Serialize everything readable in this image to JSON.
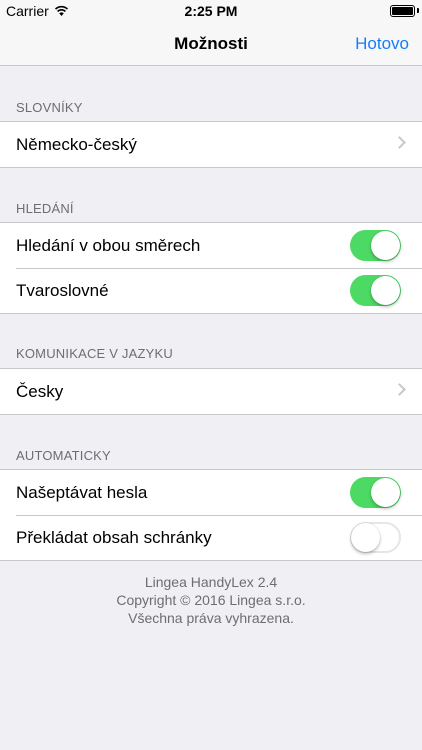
{
  "status_bar": {
    "carrier": "Carrier",
    "time": "2:25 PM",
    "wifi_icon": "wifi-icon",
    "battery_icon": "battery-icon"
  },
  "nav": {
    "title": "Možnosti",
    "done_label": "Hotovo",
    "accent_color": "#157efb"
  },
  "sections": [
    {
      "header": "SLOVNÍKY",
      "rows": [
        {
          "label": "Německo-český",
          "control": "chevron"
        }
      ]
    },
    {
      "header": "HLEDÁNÍ",
      "rows": [
        {
          "label": "Hledání v obou směrech",
          "control": "switch",
          "on": true
        },
        {
          "label": "Tvaroslovné",
          "control": "switch",
          "on": true
        }
      ]
    },
    {
      "header": "KOMUNIKACE V JAZYKU",
      "rows": [
        {
          "label": "Česky",
          "control": "chevron"
        }
      ]
    },
    {
      "header": "AUTOMATICKY",
      "rows": [
        {
          "label": "Našeptávat hesla",
          "control": "switch",
          "on": true
        },
        {
          "label": "Překládat obsah schránky",
          "control": "switch",
          "on": false
        }
      ]
    }
  ],
  "footer": {
    "line1": "Lingea HandyLex 2.4",
    "line2": "Copyright © 2016 Lingea s.r.o.",
    "line3": "Všechna práva vyhrazena."
  },
  "colors": {
    "switch_on": "#4cd964",
    "background": "#efeff4",
    "separator": "#c8c7cc"
  }
}
